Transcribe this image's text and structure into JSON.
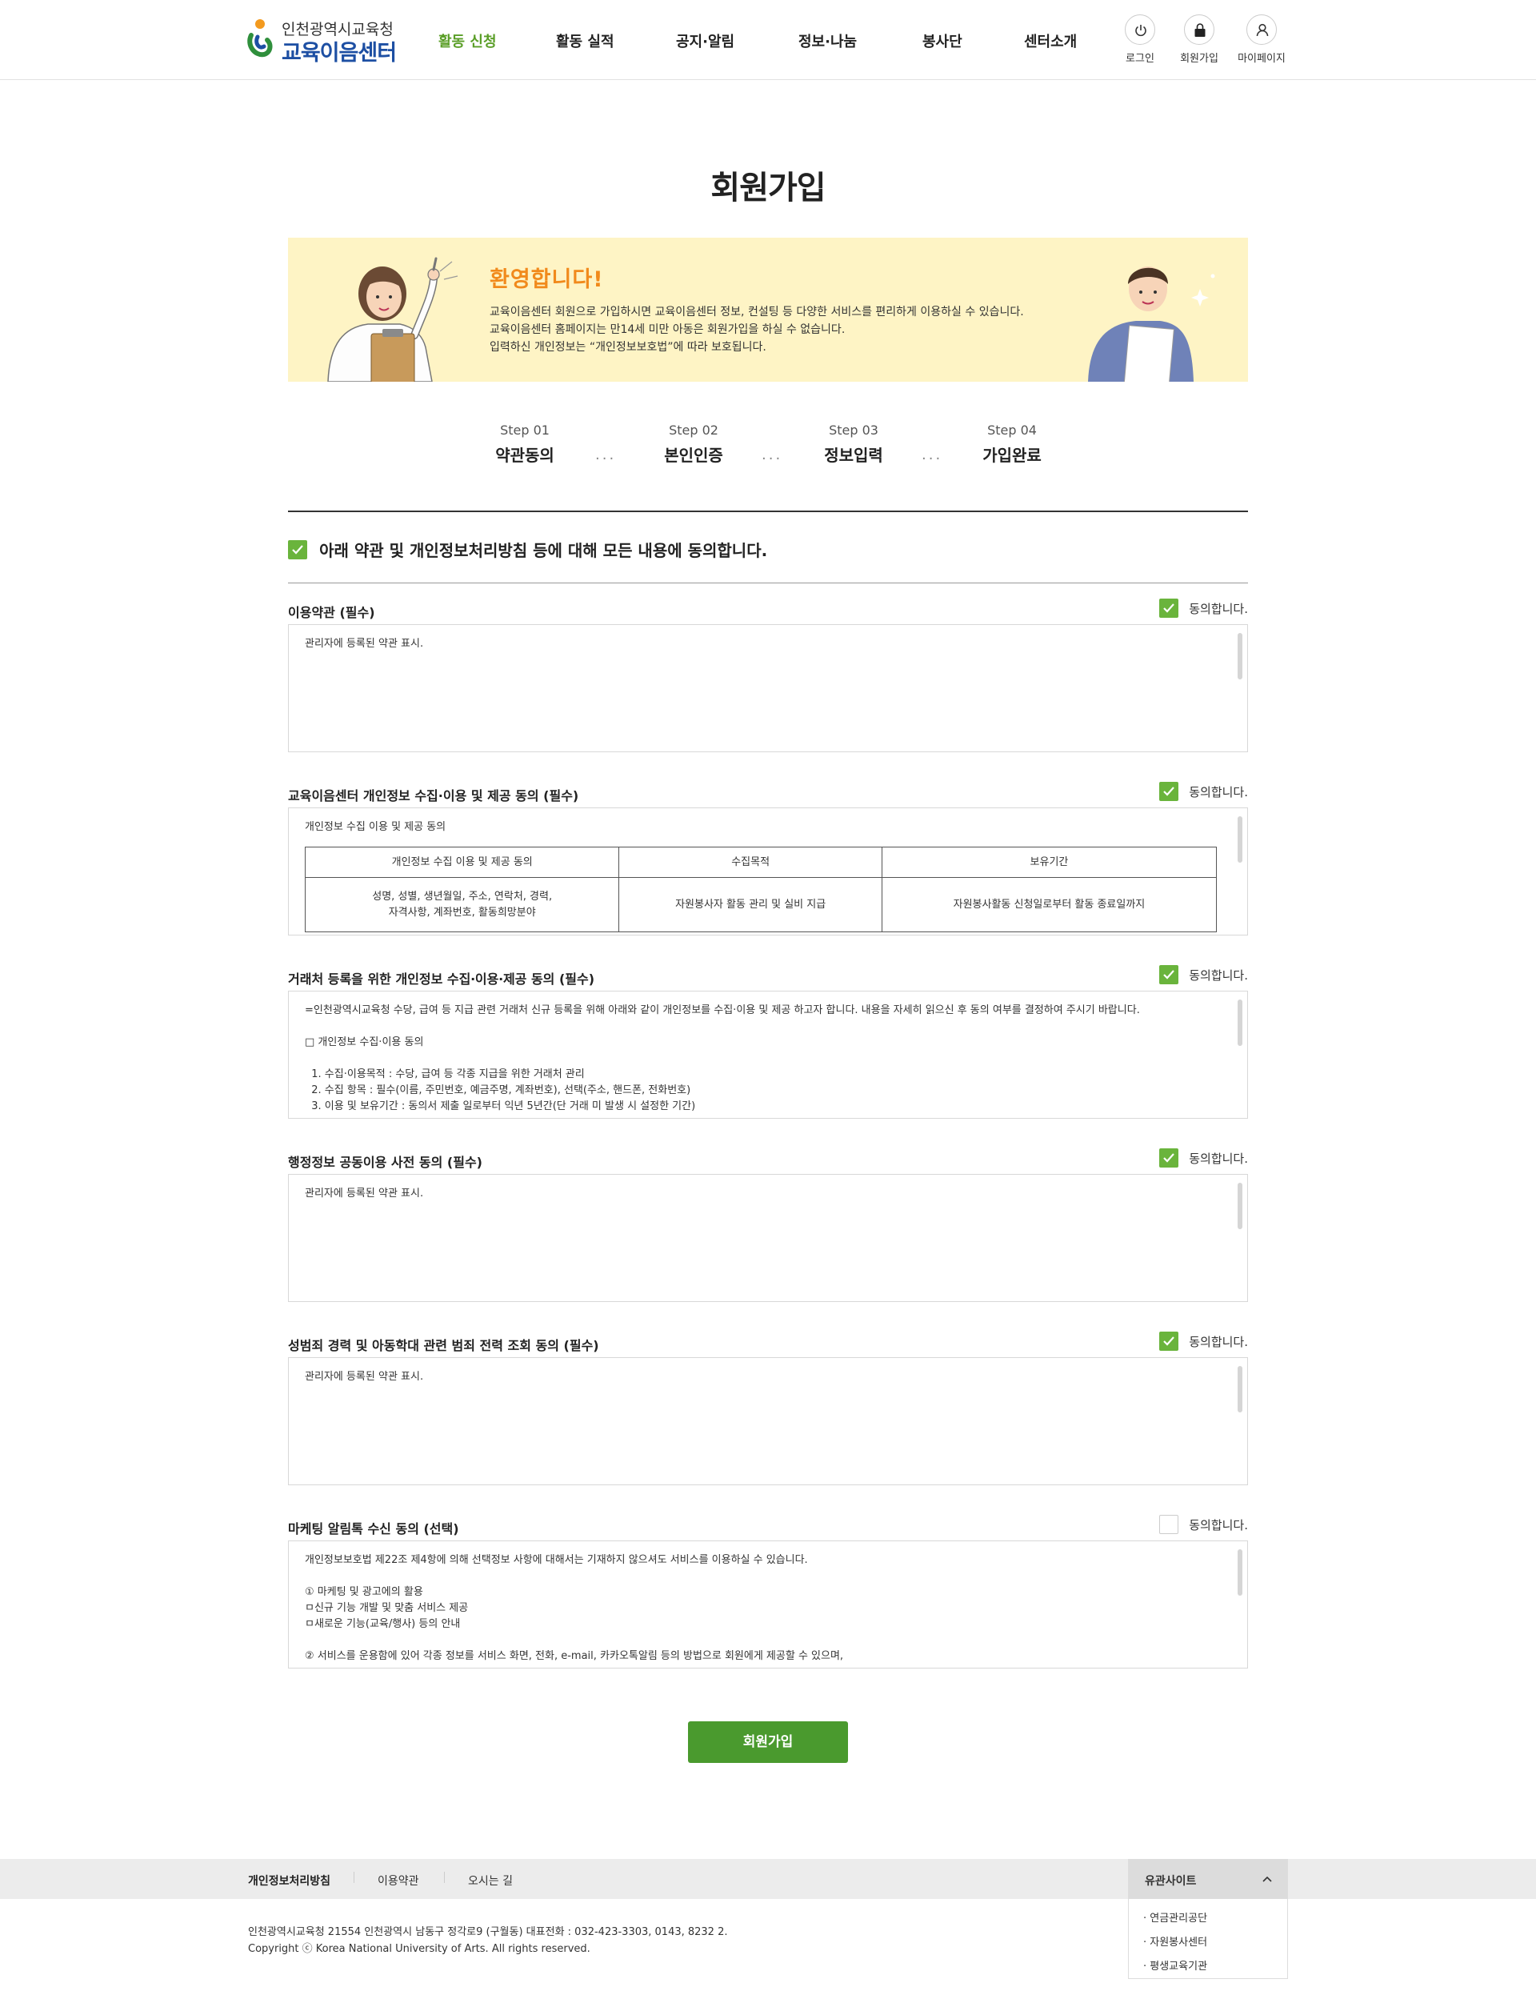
{
  "header": {
    "logo_top": "인천광역시교육청",
    "logo_main": "교육이음센터",
    "nav": [
      "활동 신청",
      "활동 실적",
      "공지·알림",
      "정보·나눔",
      "봉사단",
      "센터소개"
    ],
    "util": [
      "로그인",
      "회원가입",
      "마이페이지"
    ]
  },
  "page_title": "회원가입",
  "banner": {
    "title": "환영합니다!",
    "lines": [
      "교육이음센터 회원으로 가입하시면 교육이음센터 정보, 컨설팅 등 다양한 서비스를 편리하게 이용하실 수 있습니다.",
      "교육이음센터 홈페이지는 만14세 미만 아동은 회원가입을 하실 수 없습니다.",
      "입력하신 개인정보는 “개인정보보호법”에 따라 보호됩니다."
    ]
  },
  "steps": [
    {
      "num": "Step 01",
      "name": "약관동의"
    },
    {
      "num": "Step 02",
      "name": "본인인증"
    },
    {
      "num": "Step 03",
      "name": "정보입력"
    },
    {
      "num": "Step 04",
      "name": "가입완료"
    }
  ],
  "step_dots": "...",
  "all_agree": "아래 약관 및 개인정보처리방침 등에 대해 모든 내용에 동의합니다.",
  "agree_label": "동의합니다.",
  "terms": [
    {
      "title": "이용약관 (필수)",
      "checked": true,
      "lines": [
        "관리자에 등록된 약관 표시."
      ]
    },
    {
      "title": "교육이음센터 개인정보 수집·이용 및 제공 동의 (필수)",
      "checked": true,
      "lines": [
        "개인정보 수집 이용 및 제공 동의"
      ],
      "table": {
        "headers": [
          "개인정보 수집 이용 및 제공 동의",
          "수집목적",
          "보유기간"
        ],
        "row": [
          "성명, 성별, 생년월일, 주소, 연락처, 경력,",
          "자격사항, 계좌번호, 활동희망분야",
          "자원봉사자 활동 관리 및 실비 지급",
          "자원봉사활동 신청일로부터 활동 종료일까지"
        ]
      }
    },
    {
      "title": "거래처 등록을 위한 개인정보 수집‧이용‧제공 동의 (필수)",
      "checked": true,
      "lines": [
        "=인천광역시교육청 수당, 급여 등 지급 관련 거래처 신규 등록을 위해 아래와 같이 개인정보를 수집‧이용 및 제공 하고자 합니다. 내용을 자세히 읽으신 후 동의 여부를 결정하여 주시기 바랍니다.",
        "",
        "□ 개인정보 수집·이용 동의",
        "",
        "  1. 수집·이용목적 : 수당, 급여 등 각종 지급을 위한 거래처 관리",
        "  2. 수집 항목 : 필수(이름, 주민번호, 예금주명, 계좌번호), 선택(주소, 핸드폰, 전화번호)",
        "  3. 이용 및 보유기간 : 동의서 제출 일로부터 익년 5년간(단 거래 미 발생 시 설정한 기간)"
      ]
    },
    {
      "title": "행정정보 공동이용 사전 동의 (필수)",
      "checked": true,
      "lines": [
        "관리자에 등록된 약관 표시."
      ]
    },
    {
      "title": "성범죄 경력 및 아동학대 관련 범죄 전력 조회 동의 (필수)",
      "checked": true,
      "lines": [
        "관리자에 등록된 약관 표시."
      ]
    },
    {
      "title": "마케팅 알림톡 수신 동의 (선택)",
      "checked": false,
      "lines": [
        "개인정보보호법 제22조 제4항에 의해 선택정보 사항에 대해서는 기재하지 않으셔도 서비스를 이용하실 수 있습니다.",
        "",
        "① 마케팅 및 광고에의 활용",
        "ㅁ신규 기능 개발 및 맞춤 서비스 제공",
        "ㅁ새로운 기능(교육/행사) 등의 안내",
        "",
        "② 서비스를 운용함에 있어 각종 정보를 서비스 화면, 전화, e-mail, 카카오톡알림 등의 방법으로 회원에게 제공할 수 있으며,"
      ]
    }
  ],
  "submit": "회원가입",
  "footer": {
    "nav": [
      "개인정보처리방침",
      "이용약관",
      "오시는 길"
    ],
    "family_label": "유관사이트",
    "family_items": [
      "· 연금관리공단",
      "· 자원봉사센터",
      "· 평생교육기관"
    ],
    "address": "인천광역시교육청 21554 인천광역시 남동구 정각로9 (구월동) 대표전화 : 032-423-3303, 0143, 8232 2.",
    "copyright": "Copyright ⓒ Korea National University of Arts. All rights reserved."
  },
  "colors": {
    "accent": "#5a9e27",
    "checkbox": "#6ab43c",
    "submit": "#4a9a2e",
    "banner_bg": "#fef4c5",
    "banner_title": "#f18a1c",
    "logo_blue": "#1d4fa3"
  }
}
